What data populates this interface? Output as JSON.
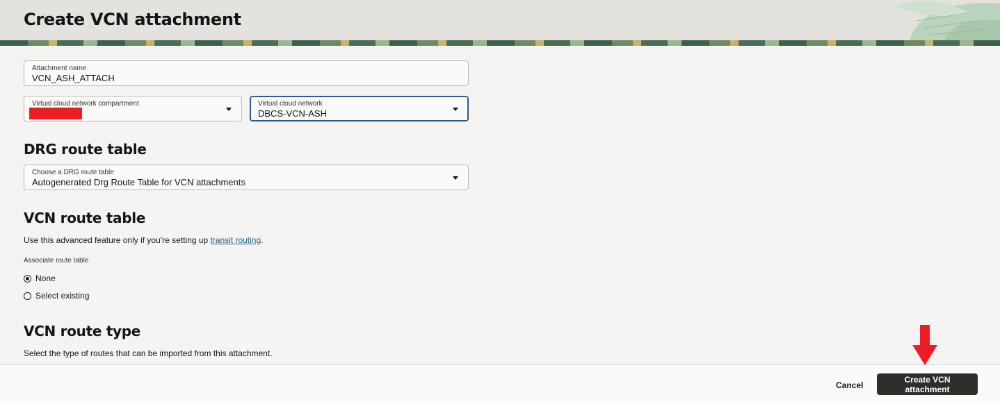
{
  "header": {
    "title": "Create VCN attachment"
  },
  "form": {
    "attachment_name": {
      "label": "Attachment name",
      "value": "VCN_ASH_ATTACH"
    },
    "compartment": {
      "label": "Virtual cloud network compartment",
      "value": ""
    },
    "vcn": {
      "label": "Virtual cloud network",
      "value": "DBCS-VCN-ASH"
    }
  },
  "drg_section": {
    "heading": "DRG route table",
    "select_label": "Choose a DRG route table",
    "select_value": "Autogenerated Drg Route Table for VCN attachments"
  },
  "vcn_route_section": {
    "heading": "VCN route table",
    "description_prefix": "Use this advanced feature only if you're setting up ",
    "link_text": "transit routing",
    "description_suffix": ".",
    "associate_label": "Associate route table",
    "options": [
      {
        "label": "None",
        "checked": true
      },
      {
        "label": "Select existing",
        "checked": false
      }
    ]
  },
  "route_type_section": {
    "heading": "VCN route type",
    "description": "Select the type of routes that can be imported from this attachment."
  },
  "footer": {
    "cancel_label": "Cancel",
    "create_label": "Create VCN attachment"
  },
  "colors": {
    "primary_button": "#312d2a",
    "focus_border": "#2c5a8a",
    "redaction": "#ee1c25",
    "annotation_arrow": "#ee1c25",
    "link": "#1f5c8e"
  }
}
